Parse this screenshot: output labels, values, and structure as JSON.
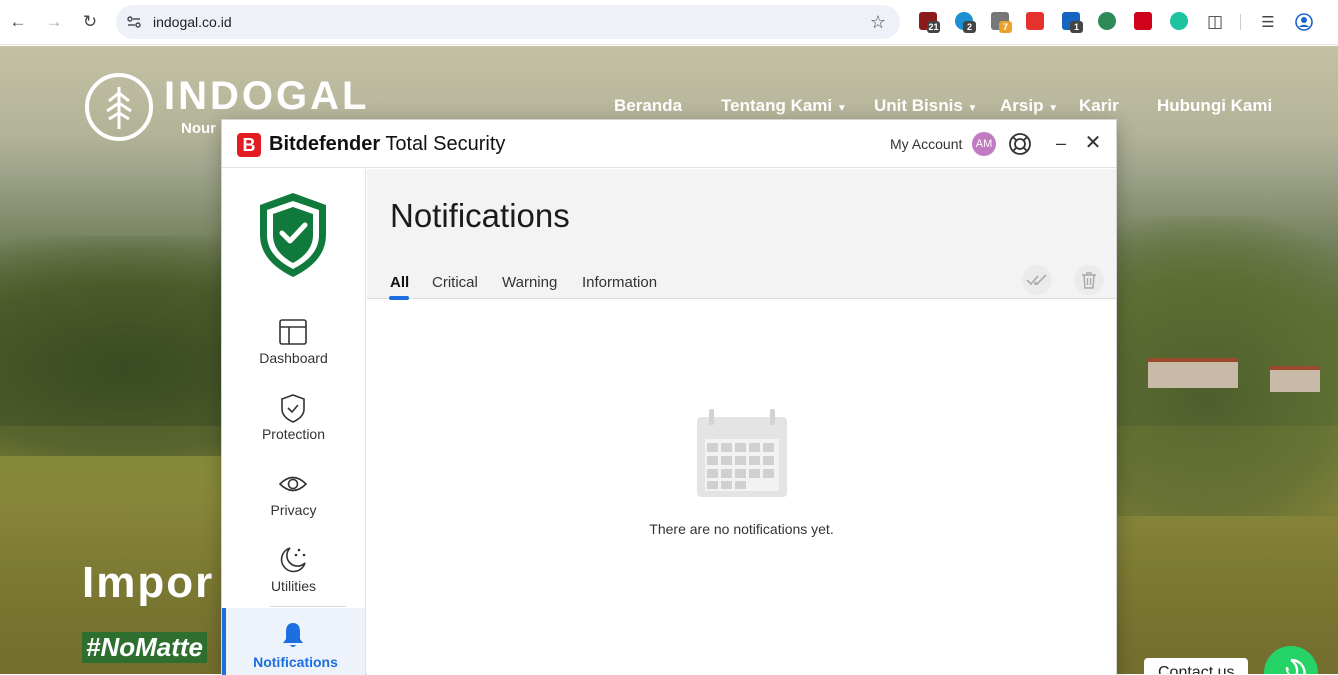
{
  "browser": {
    "url": "indogal.co.id",
    "extensions": [
      {
        "name": "ext-1",
        "badge": "21",
        "color": "#8b1b1b"
      },
      {
        "name": "ext-2",
        "badge": "2",
        "color": "#1a8fd1"
      },
      {
        "name": "ext-3",
        "badge": "7",
        "color": "#555555"
      },
      {
        "name": "ext-4",
        "badge": "",
        "color": "#e5322d"
      },
      {
        "name": "ext-5",
        "badge": "1",
        "color": "#1565c0"
      },
      {
        "name": "ext-6",
        "badge": "",
        "color": "#2e8b57"
      },
      {
        "name": "ext-7",
        "badge": "",
        "color": "#d0021b"
      },
      {
        "name": "ext-8",
        "badge": "",
        "color": "#1ec3a0"
      }
    ]
  },
  "site": {
    "logo": "INDOGAL",
    "logo_sub": "Nour",
    "menu": [
      "Beranda",
      "Tentang Kami",
      "Unit Bisnis",
      "Arsip",
      "Karir",
      "Hubungi Kami"
    ],
    "hero_title": "Impor",
    "hashtag": "#NoMatte",
    "contact_label": "Contact us"
  },
  "bitdefender": {
    "brand_bold": "Bitdefender",
    "brand_rest": "Total Security",
    "account_label": "My Account",
    "avatar_initials": "AM",
    "sidebar": [
      {
        "label": "Dashboard",
        "icon": "dashboard-icon"
      },
      {
        "label": "Protection",
        "icon": "protection-icon"
      },
      {
        "label": "Privacy",
        "icon": "eye-icon"
      },
      {
        "label": "Utilities",
        "icon": "utilities-icon"
      },
      {
        "label": "Notifications",
        "icon": "bell-icon",
        "active": true
      }
    ],
    "page_title": "Notifications",
    "tabs": [
      {
        "label": "All",
        "active": true
      },
      {
        "label": "Critical"
      },
      {
        "label": "Warning"
      },
      {
        "label": "Information"
      }
    ],
    "empty_message": "There are no notifications yet.",
    "accent": "#1b6fe0",
    "brand_red": "#e41b23",
    "shield_green": "#0f7a3c"
  }
}
